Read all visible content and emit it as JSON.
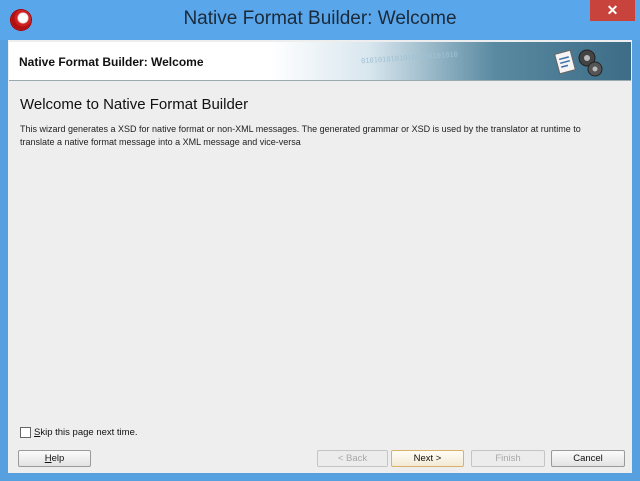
{
  "window": {
    "title": "Native Format Builder: Welcome",
    "close_symbol": "✕",
    "app_icon": "oracle-jdeveloper-icon"
  },
  "banner": {
    "title": "Native Format Builder: Welcome",
    "binary_text": "01010101010101010101010",
    "icon": "wizard-gears-icon"
  },
  "page": {
    "heading": "Welcome to Native Format Builder",
    "description_line1": "This wizard generates a XSD for native format or non-XML messages. The generated grammar or XSD is used by the translator at runtime to",
    "description_line2": "translate a native format message into a XML message and vice-versa"
  },
  "skip": {
    "label": "Skip this page next time.",
    "checked": false
  },
  "buttons": {
    "help": "Help",
    "back": "< Back",
    "next": "Next >",
    "finish": "Finish",
    "cancel": "Cancel"
  },
  "colors": {
    "titlebar": "#5aa6ea",
    "close": "#c7433c",
    "client": "#eeeeee"
  }
}
